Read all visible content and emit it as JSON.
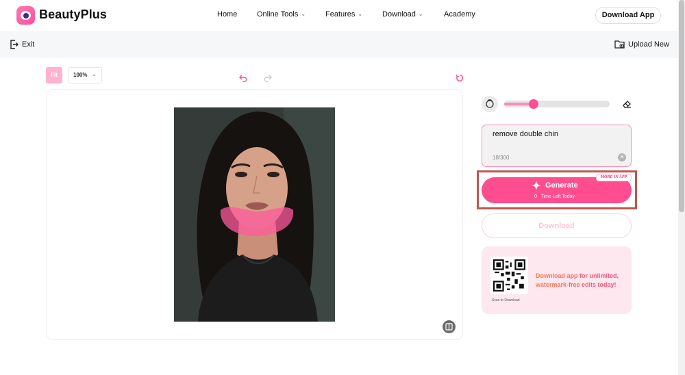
{
  "brand": {
    "name": "BeautyPlus",
    "accent": "#ff4d8f"
  },
  "nav": {
    "items": [
      {
        "label": "Home",
        "dropdown": false
      },
      {
        "label": "Online Tools",
        "dropdown": true
      },
      {
        "label": "Features",
        "dropdown": true
      },
      {
        "label": "Download",
        "dropdown": true
      },
      {
        "label": "Academy",
        "dropdown": false
      }
    ],
    "cta_label": "Download App"
  },
  "toolbar": {
    "exit_label": "Exit",
    "upload_label": "Upload New"
  },
  "editor": {
    "fit_label": "Fit",
    "zoom_value": "100%",
    "icons": [
      "undo-icon",
      "redo-icon",
      "reset-icon",
      "compare-icon"
    ]
  },
  "panel": {
    "brush_size_level": 0.28,
    "prompt": {
      "value": "remove double chin",
      "counter": "18/300"
    },
    "generate": {
      "label": "Generate",
      "sub": "0   Time Left Today",
      "tag": "MORE IN APP"
    },
    "download_label": "Download",
    "promo": {
      "text": "Download app for unlimited, watermark-free edits today!",
      "scan_label": "Scan to Download"
    }
  }
}
